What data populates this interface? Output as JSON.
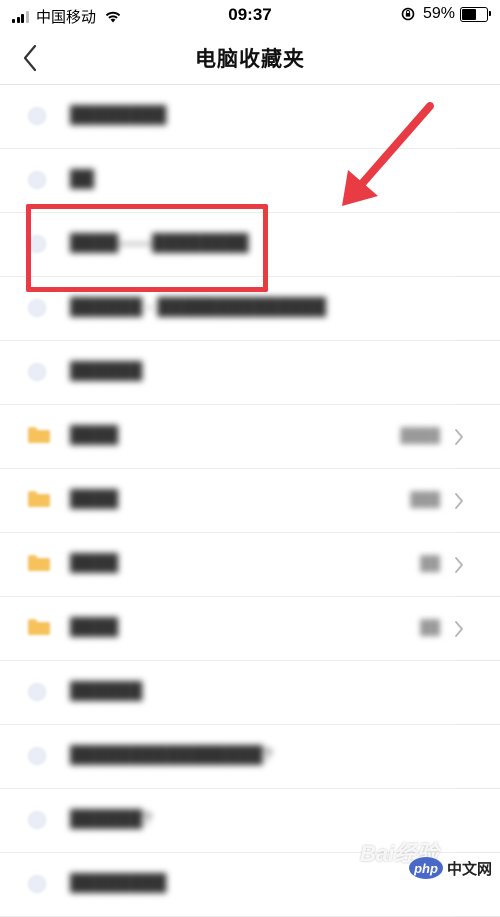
{
  "status_bar": {
    "carrier": "中国移动",
    "time": "09:37",
    "battery": "59%",
    "battery_level": 0.59
  },
  "nav": {
    "title": "电脑收藏夹"
  },
  "list": [
    {
      "type": "bookmark",
      "label": "████████"
    },
    {
      "type": "bookmark",
      "label": "██"
    },
    {
      "type": "bookmark",
      "label": "████——████████"
    },
    {
      "type": "bookmark",
      "label": "██████ - ██████████████"
    },
    {
      "type": "bookmark",
      "label": "██████"
    },
    {
      "type": "folder",
      "label": "████",
      "count": "████"
    },
    {
      "type": "folder",
      "label": "████",
      "count": "███"
    },
    {
      "type": "folder",
      "label": "████",
      "count": "██"
    },
    {
      "type": "folder",
      "label": "████",
      "count": "██"
    },
    {
      "type": "bookmark",
      "label": "██████"
    },
    {
      "type": "bookmark",
      "label": "████████████████?"
    },
    {
      "type": "bookmark",
      "label": "██████?"
    },
    {
      "type": "bookmark",
      "label": "████████"
    }
  ],
  "annotation": {
    "color": "#e83b43"
  },
  "watermarks": {
    "baidu": "Bai经验",
    "php_badge": "php",
    "php_text": "中文网"
  }
}
